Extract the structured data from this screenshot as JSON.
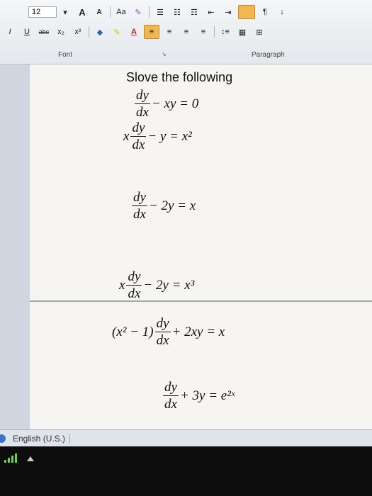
{
  "ribbon": {
    "font_size": "12",
    "font_group_label": "Font",
    "paragraph_group_label": "Paragraph",
    "row1": {
      "grow_font": "A",
      "shrink_font": "A",
      "change_case": "Aa",
      "bullets": "☰",
      "numbering": "☷",
      "multilevel": "☶",
      "decrease_indent": "⇤",
      "increase_indent": "⇥",
      "show_marks": "¶",
      "sort": "↓"
    },
    "row2": {
      "italic": "I",
      "underline": "U",
      "strikethrough": "abc",
      "subscript": "x₂",
      "superscript": "x²",
      "font_color_a": "A",
      "align_left": "≡",
      "center": "≡",
      "align_right": "≡",
      "justify": "≡",
      "line_spacing": "↕≡",
      "shading": "▦",
      "borders": "⊞"
    }
  },
  "document": {
    "title": "Slove the following",
    "equations": [
      {
        "prefix": "",
        "num": "dy",
        "den": "dx",
        "suffix": "− xy = 0"
      },
      {
        "prefix": "x",
        "num": "dy",
        "den": "dx",
        "suffix": "− y = x²"
      },
      {
        "prefix": "",
        "num": "dy",
        "den": "dx",
        "suffix": "− 2y = x"
      },
      {
        "prefix": "x",
        "num": "dy",
        "den": "dx",
        "suffix": "− 2y = x³"
      },
      {
        "prefix": "(x² − 1)",
        "num": "dy",
        "den": "dx",
        "suffix": "+ 2xy = x"
      },
      {
        "prefix": "",
        "num": "dy",
        "den": "dx",
        "suffix": "+ 3y = e²ˣ"
      }
    ]
  },
  "statusbar": {
    "language": "English (U.S.)"
  }
}
